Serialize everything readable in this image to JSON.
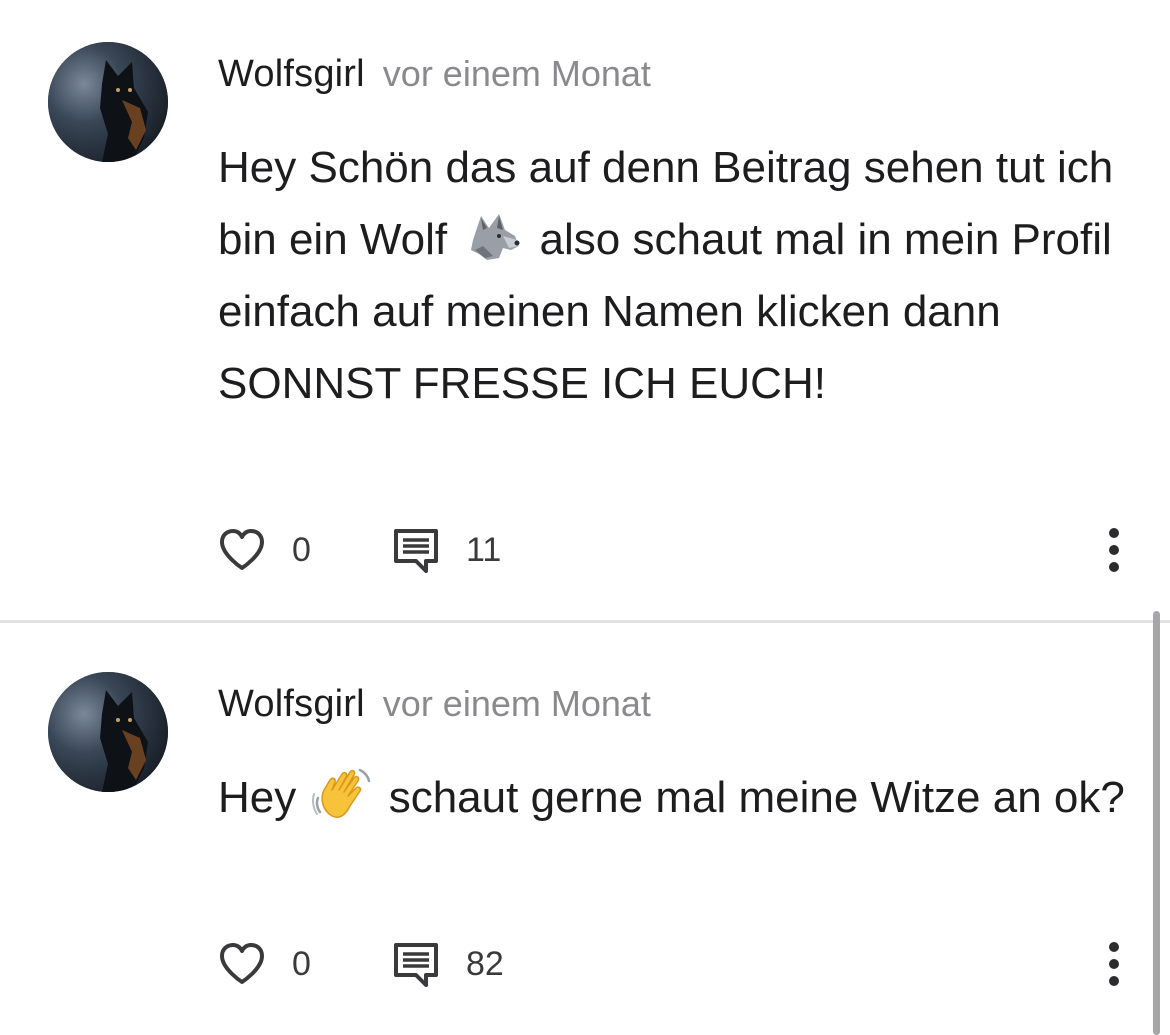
{
  "comments": [
    {
      "author": "Wolfsgirl",
      "time": "vor einem Monat",
      "text_part1": "Hey Schön das auf denn Beitrag sehen tut ich bin ein Wolf ",
      "emoji": "wolf-emoji",
      "text_part2": " also schaut mal in mein Profil einfach auf meinen Namen klicken dann SONNST FRESSE ICH EUCH!",
      "likes": "0",
      "replies": "11"
    },
    {
      "author": "Wolfsgirl",
      "time": "vor einem Monat",
      "text_part1": "Hey ",
      "emoji": "waving-hand-emoji",
      "text_part2": " schaut gerne mal meine Witze an ok?",
      "likes": "0",
      "replies": "82"
    }
  ],
  "icons": {
    "like": "heart-outline-icon",
    "reply": "comment-icon",
    "more": "more-vertical-icon"
  },
  "colors": {
    "text": "#1d1d1f",
    "muted": "#8a8a8e",
    "divider": "#e3e3e5",
    "icon": "#3a3a3c"
  }
}
